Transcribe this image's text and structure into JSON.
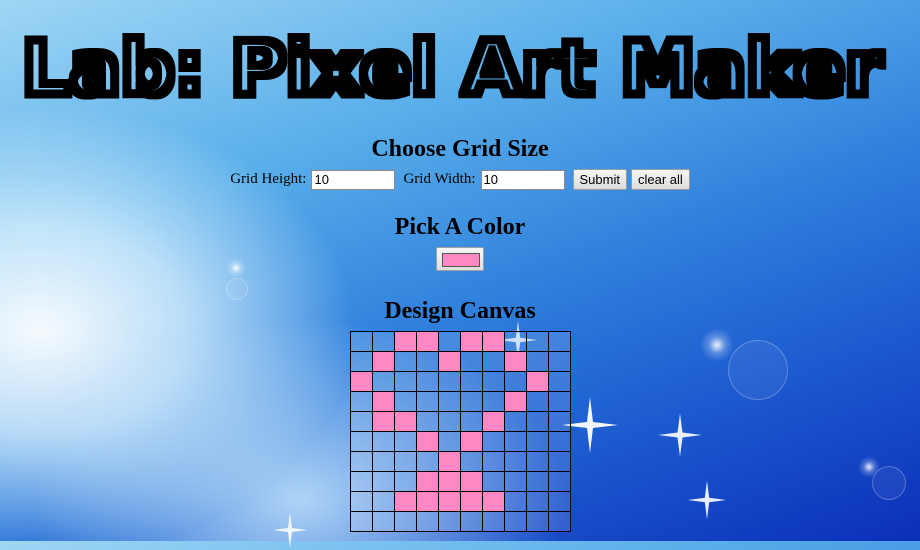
{
  "title": "Lab: Pixel Art Maker",
  "grid_size": {
    "heading": "Choose Grid Size",
    "height_label": "Grid Height:",
    "height_value": "10",
    "width_label": "Grid Width:",
    "width_value": "10",
    "submit_label": "Submit",
    "clear_label": "clear all"
  },
  "color": {
    "heading": "Pick A Color",
    "value": "#ff88c4"
  },
  "canvas": {
    "heading": "Design Canvas",
    "rows": 10,
    "cols": 10,
    "painted_color": "#ff88c4",
    "painted": [
      [
        0,
        2
      ],
      [
        0,
        3
      ],
      [
        0,
        5
      ],
      [
        0,
        6
      ],
      [
        1,
        1
      ],
      [
        1,
        4
      ],
      [
        1,
        7
      ],
      [
        2,
        0
      ],
      [
        2,
        8
      ],
      [
        3,
        1
      ],
      [
        3,
        7
      ],
      [
        4,
        1
      ],
      [
        4,
        2
      ],
      [
        4,
        6
      ],
      [
        5,
        3
      ],
      [
        5,
        5
      ],
      [
        6,
        4
      ],
      [
        7,
        3
      ],
      [
        7,
        4
      ],
      [
        7,
        5
      ],
      [
        8,
        2
      ],
      [
        8,
        3
      ],
      [
        8,
        4
      ],
      [
        8,
        5
      ],
      [
        8,
        6
      ]
    ]
  }
}
